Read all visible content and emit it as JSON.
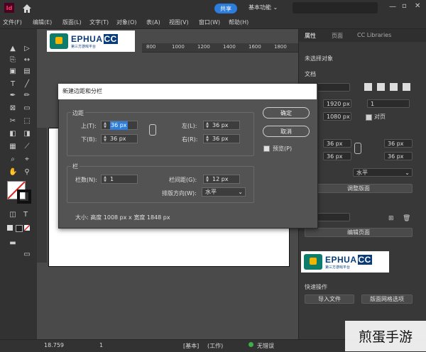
{
  "app": {
    "id_logo": "Id",
    "share": "共享",
    "workspace": "基本功能",
    "menus": [
      "文件(F)",
      "编辑(E)",
      "版面(L)",
      "文字(T)",
      "对象(O)",
      "表(A)",
      "视图(V)",
      "窗口(W)",
      "帮助(H)"
    ]
  },
  "ruler": {
    "marks": [
      "800",
      "1000",
      "1200",
      "1400",
      "1600",
      "1800"
    ]
  },
  "brand": {
    "name": "EPHUA",
    "suffix": "CC",
    "tagline": "第三方游戏平台"
  },
  "panel": {
    "tabs": [
      "属性",
      "页面",
      "CC Libraries"
    ],
    "no_selection": "未选择对象",
    "document": "文档",
    "width_value": "1920 px",
    "height_value": "1080 px",
    "pages_value": "1",
    "facing_label": "对页",
    "margin_value_1": "36 px",
    "margin_value_2": "36 px",
    "margin_value_3": "36 px",
    "margin_value_4": "36 px",
    "orientation": "水平",
    "adjust_layout": "调整版面",
    "edit_page": "编辑页面",
    "quick_actions": "快速操作",
    "import_file": "导入文件",
    "layout_grid": "版面网格选项"
  },
  "dialog": {
    "title": "新建边距和分栏",
    "margins_group": "边距",
    "top_label": "上(T):",
    "top_value": "36 px",
    "bottom_label": "下(B):",
    "bottom_value": "36 px",
    "left_label": "左(L):",
    "left_value": "36 px",
    "right_label": "右(R):",
    "right_value": "36 px",
    "columns_group": "栏",
    "columns_label": "栏数(N):",
    "columns_value": "1",
    "gutter_label": "栏间距(G):",
    "gutter_value": "12 px",
    "direction_label": "排版方向(W):",
    "direction_value": "水平",
    "size_text": "大小: 高度 1008 px x 宽度 1848 px",
    "ok": "确定",
    "cancel": "取消",
    "preview": "预览(P)"
  },
  "status": {
    "zoom": "18.759",
    "page": "1",
    "mode": "[基本]",
    "work": "(工作)",
    "errors": "无错误"
  },
  "watermark": "煎蛋手游"
}
